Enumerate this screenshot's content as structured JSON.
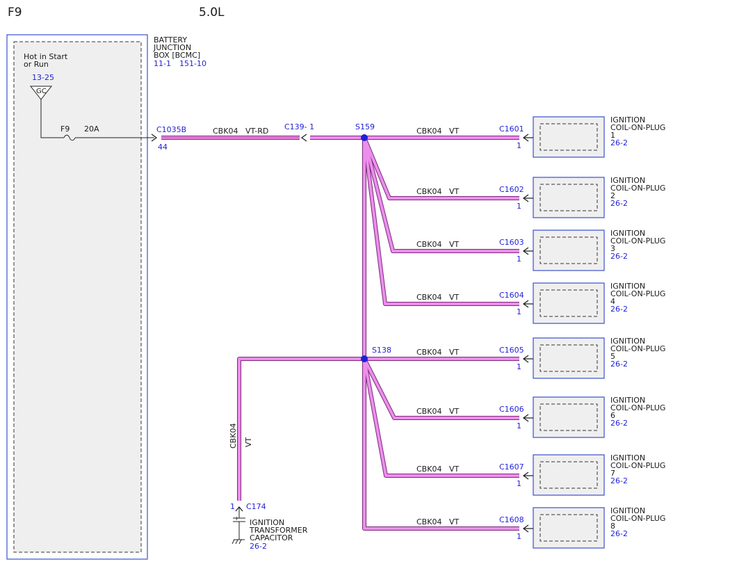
{
  "header": {
    "fuse_label": "F9",
    "engine": "5.0L"
  },
  "bjb": {
    "name_lines": [
      "BATTERY",
      "JUNCTION",
      "BOX [BCMC]"
    ],
    "refs": [
      "11-1",
      "151-10"
    ],
    "power_note_lines": [
      "Hot in Start",
      "or Run"
    ],
    "gc_ref": "13-25",
    "gc_label": "GC",
    "fuse_name": "F9",
    "fuse_rating": "20A",
    "connector": "C1035B",
    "pin": "44"
  },
  "main_wire": {
    "circuit": "CBK04",
    "color_code": "VT-RD"
  },
  "inline_connector": {
    "label": "C139- 1"
  },
  "splices": {
    "upper": "S159",
    "lower": "S138"
  },
  "branch_wire": {
    "circuit": "CBK04",
    "color_code": "VT"
  },
  "coils": [
    {
      "connector": "C1601",
      "pin": "1",
      "label_lines": [
        "IGNITION",
        "COIL-ON-PLUG",
        "1"
      ],
      "ref": "26-2"
    },
    {
      "connector": "C1602",
      "pin": "1",
      "label_lines": [
        "IGNITION",
        "COIL-ON-PLUG",
        "2"
      ],
      "ref": "26-2"
    },
    {
      "connector": "C1603",
      "pin": "1",
      "label_lines": [
        "IGNITION",
        "COIL-ON-PLUG",
        "3"
      ],
      "ref": "26-2"
    },
    {
      "connector": "C1604",
      "pin": "1",
      "label_lines": [
        "IGNITION",
        "COIL-ON-PLUG",
        "4"
      ],
      "ref": "26-2"
    },
    {
      "connector": "C1605",
      "pin": "1",
      "label_lines": [
        "IGNITION",
        "COIL-ON-PLUG",
        "5"
      ],
      "ref": "26-2"
    },
    {
      "connector": "C1606",
      "pin": "1",
      "label_lines": [
        "IGNITION",
        "COIL-ON-PLUG",
        "6"
      ],
      "ref": "26-2"
    },
    {
      "connector": "C1607",
      "pin": "1",
      "label_lines": [
        "IGNITION",
        "COIL-ON-PLUG",
        "7"
      ],
      "ref": "26-2"
    },
    {
      "connector": "C1608",
      "pin": "1",
      "label_lines": [
        "IGNITION",
        "COIL-ON-PLUG",
        "8"
      ],
      "ref": "26-2"
    }
  ],
  "capacitor": {
    "pin": "1",
    "connector": "C174",
    "label_lines": [
      "IGNITION",
      "TRANSFORMER",
      "CAPACITOR"
    ],
    "ref": "26-2",
    "polarity": "+"
  },
  "colors": {
    "wire_fill": "#ec8fec",
    "wire_edge": "#7a2a7a",
    "box_border": "#3a4fd0",
    "ref_text": "#1f1fd6",
    "splice_dot": "#1f1fd6",
    "bjb_wire": "#e0417a"
  }
}
